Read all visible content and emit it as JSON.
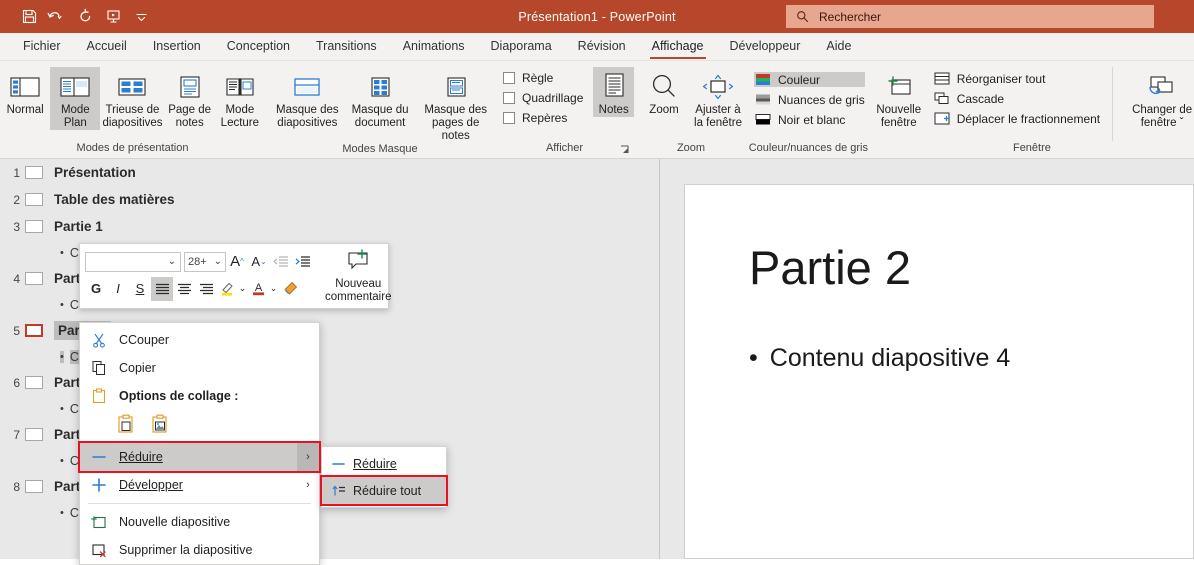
{
  "titlebar": {
    "title": "Présentation1  -  PowerPoint",
    "bg_color": "#b7472a",
    "quick_access": [
      {
        "name": "save-icon",
        "label": "Enregistrer"
      },
      {
        "name": "undo-icon",
        "label": "Annuler"
      },
      {
        "name": "redo-icon",
        "label": "Rétablir"
      },
      {
        "name": "start-slideshow-icon",
        "label": "Démarrer le diaporama"
      },
      {
        "name": "customize-quick-access-icon",
        "label": "Personnaliser"
      }
    ],
    "search": {
      "placeholder": "Rechercher",
      "icon": "search-icon"
    }
  },
  "tabs": [
    {
      "label": "Fichier",
      "active": false
    },
    {
      "label": "Accueil",
      "active": false
    },
    {
      "label": "Insertion",
      "active": false
    },
    {
      "label": "Conception",
      "active": false
    },
    {
      "label": "Transitions",
      "active": false
    },
    {
      "label": "Animations",
      "active": false
    },
    {
      "label": "Diaporama",
      "active": false
    },
    {
      "label": "Révision",
      "active": false
    },
    {
      "label": "Affichage",
      "active": true
    },
    {
      "label": "Développeur",
      "active": false
    },
    {
      "label": "Aide",
      "active": false
    }
  ],
  "ribbon": {
    "groups": [
      {
        "name": "Modes de présentation",
        "title": "Modes de présentation",
        "buttons": [
          {
            "label": "Normal",
            "icon": "normal-view-icon",
            "selected": false
          },
          {
            "label": "Mode Plan",
            "icon": "outline-view-icon",
            "selected": true
          },
          {
            "label": "Trieuse de diapositives",
            "icon": "slide-sorter-icon",
            "selected": false
          },
          {
            "label": "Page de notes",
            "icon": "notes-page-icon",
            "selected": false
          },
          {
            "label": "Mode Lecture",
            "icon": "reading-view-icon",
            "selected": false
          }
        ]
      },
      {
        "name": "Modes Masque",
        "title": "Modes Masque",
        "buttons": [
          {
            "label": "Masque des diapositives",
            "icon": "slide-master-icon",
            "selected": false
          },
          {
            "label": "Masque du document",
            "icon": "handout-master-icon",
            "selected": false
          },
          {
            "label": "Masque des pages de notes",
            "icon": "notes-master-icon",
            "selected": false
          }
        ]
      },
      {
        "name": "Afficher",
        "title": "Afficher",
        "checkboxes": [
          {
            "label": "Règle",
            "checked": false
          },
          {
            "label": "Quadrillage",
            "checked": false
          },
          {
            "label": "Repères",
            "checked": false
          }
        ],
        "buttons": [
          {
            "label": "Notes",
            "icon": "notes-icon",
            "selected": true
          }
        ],
        "dialog_launcher": true
      },
      {
        "name": "Zoom",
        "title": "Zoom",
        "buttons": [
          {
            "label": "Zoom",
            "icon": "zoom-icon",
            "selected": false
          },
          {
            "label": "Ajuster à la fenêtre",
            "icon": "fit-to-window-icon",
            "selected": false
          }
        ]
      },
      {
        "name": "Couleur/nuances de gris",
        "title": "Couleur/nuances de gris",
        "items": [
          {
            "label": "Couleur",
            "icon": "color-icon",
            "selected": true
          },
          {
            "label": "Nuances de gris",
            "icon": "grayscale-icon",
            "selected": false
          },
          {
            "label": "Noir et blanc",
            "icon": "blackwhite-icon",
            "selected": false
          }
        ]
      },
      {
        "name": "Fenêtre",
        "title": "Fenêtre",
        "buttons": [
          {
            "label": "Nouvelle fenêtre",
            "icon": "new-window-icon"
          },
          {
            "label": "Changer de fenêtre",
            "icon": "switch-window-icon",
            "caret": "ˇ"
          }
        ],
        "items": [
          {
            "label": "Réorganiser tout",
            "icon": "arrange-all-icon"
          },
          {
            "label": "Cascade",
            "icon": "cascade-icon"
          },
          {
            "label": "Déplacer le fractionnement",
            "icon": "move-split-icon"
          }
        ]
      }
    ]
  },
  "outline": {
    "rows": [
      {
        "num": "1",
        "title": "Présentation",
        "current": false,
        "selected": false,
        "sub": null
      },
      {
        "num": "2",
        "title": "Table des matières",
        "current": false,
        "selected": false,
        "sub": null
      },
      {
        "num": "3",
        "title": "Partie 1",
        "current": false,
        "selected": false,
        "sub": "Contenu diapositive 2"
      },
      {
        "num": "4",
        "title": "Partie",
        "current": false,
        "selected": false,
        "sub": "Conte"
      },
      {
        "num": "5",
        "title": "Partie 2",
        "current": true,
        "selected": true,
        "sub": "Conte"
      },
      {
        "num": "6",
        "title": "Partie",
        "current": false,
        "selected": false,
        "sub": "Conte"
      },
      {
        "num": "7",
        "title": "Partie",
        "current": false,
        "selected": false,
        "sub": "Conte"
      },
      {
        "num": "8",
        "title": "Partie",
        "current": false,
        "selected": false,
        "sub": "Conte"
      }
    ]
  },
  "slide": {
    "title": "Partie 2",
    "bullet": "•",
    "body": "Contenu diapositive 4"
  },
  "mini_toolbar": {
    "font_name": "",
    "font_size": "28+",
    "buttons": [
      {
        "name": "grow-font-icon",
        "label": "A"
      },
      {
        "name": "shrink-font-icon",
        "label": "A"
      },
      {
        "name": "decrease-indent-icon",
        "label": ""
      },
      {
        "name": "increase-indent-icon",
        "label": ""
      },
      {
        "name": "bold-button",
        "label": "G"
      },
      {
        "name": "italic-button",
        "label": "I"
      },
      {
        "name": "underline-button",
        "label": "S"
      },
      {
        "name": "align-left-button",
        "label": ""
      },
      {
        "name": "align-center-button",
        "label": ""
      },
      {
        "name": "align-right-button",
        "label": ""
      },
      {
        "name": "highlight-color-button",
        "label": ""
      },
      {
        "name": "font-color-button",
        "label": "A"
      },
      {
        "name": "format-painter-button",
        "label": ""
      }
    ],
    "new_comment": "Nouveau commentaire"
  },
  "context_menu": {
    "items": [
      {
        "label": "Couper",
        "icon": "cut-icon",
        "accel": "C",
        "bold": false,
        "submenu": false,
        "highlighted": false
      },
      {
        "label": "Copier",
        "icon": "copy-icon",
        "accel": "C",
        "bold": false,
        "submenu": false,
        "highlighted": false
      },
      {
        "label": "Options de collage :",
        "icon": "paste-icon",
        "bold": true,
        "submenu": false,
        "highlighted": false
      }
    ],
    "paste_options": [
      {
        "name": "paste-keep-text-icon"
      },
      {
        "name": "paste-picture-icon"
      }
    ],
    "collapse": {
      "label": "Réduire",
      "icon": "minus-icon",
      "highlighted": true,
      "boxed": true,
      "arrow": "›"
    },
    "expand": {
      "label": "Développer",
      "icon": "plus-icon",
      "highlighted": false,
      "boxed": false,
      "arrow": "›"
    },
    "after": [
      {
        "label": "Nouvelle diapositive",
        "icon": "new-slide-icon"
      },
      {
        "label": "Supprimer la diapositive",
        "icon": "delete-slide-icon"
      }
    ]
  },
  "submenu": {
    "items": [
      {
        "label": "Réduire",
        "icon": "collapse-icon",
        "highlighted": false,
        "boxed": false
      },
      {
        "label": "Réduire tout",
        "icon": "collapse-all-icon",
        "highlighted": true,
        "boxed": true
      }
    ]
  },
  "colors": {
    "accent": "#b7472a",
    "highlight_box": "#e81123",
    "menu_highlight": "#cdcbc9",
    "panel_bg": "#e8e8e8"
  }
}
